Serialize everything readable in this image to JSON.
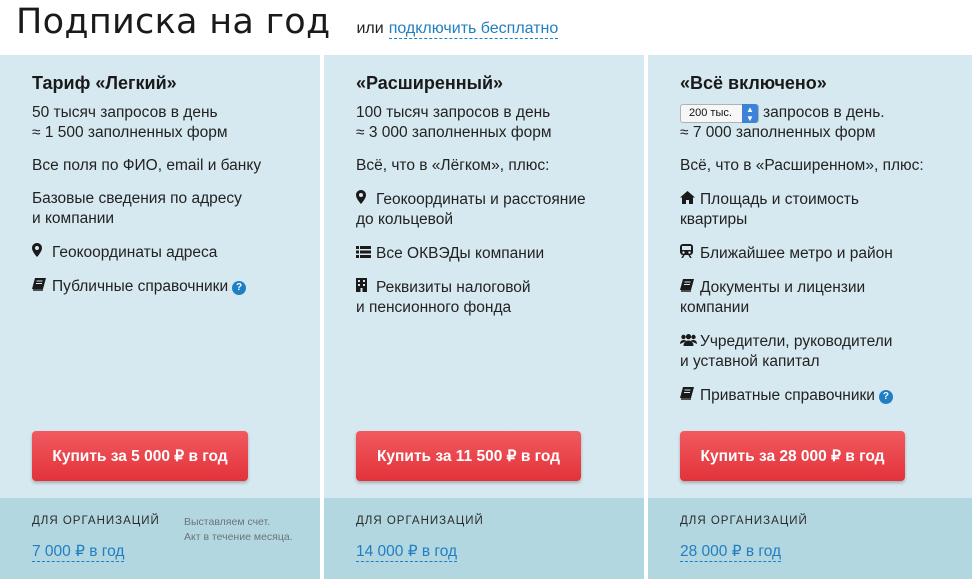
{
  "header": {
    "title": "Подписка на год",
    "or_text": "или",
    "free_link": "подключить бесплатно"
  },
  "plans": [
    {
      "title": "Тариф «Легкий»",
      "quota_lines": [
        "50 тысяч запросов в день",
        "≈ 1 500 заполненных форм"
      ],
      "intro": "Все поля по ФИО, email и банку",
      "features": [
        {
          "text": [
            "Базовые сведения по адресу",
            "и компании"
          ],
          "icon": ""
        },
        {
          "text": [
            "Геокоординаты адреса"
          ],
          "icon": "map-marker-icon"
        },
        {
          "text": [
            "Публичные справочники"
          ],
          "icon": "book-icon",
          "help": true
        }
      ],
      "buy_label": "Купить за 5 000 ₽ в год",
      "org_label": "ДЛЯ ОРГАНИЗАЦИЙ",
      "org_price": "7 000 ₽ в год",
      "org_note": [
        "Выставляем счет.",
        "Акт в течение месяца."
      ]
    },
    {
      "title": "«Расширенный»",
      "quota_lines": [
        "100 тысяч запросов в день",
        "≈ 3 000 заполненных форм"
      ],
      "intro": "Всё, что в «Лёгком», плюс:",
      "features": [
        {
          "text": [
            "Геокоординаты и расстояние",
            "до кольцевой"
          ],
          "icon": "map-marker-icon"
        },
        {
          "text": [
            "Все ОКВЭДы компании"
          ],
          "icon": "list-icon"
        },
        {
          "text": [
            "Реквизиты налоговой",
            "и пенсионного фонда"
          ],
          "icon": "building-icon"
        }
      ],
      "buy_label": "Купить за 11 500 ₽ в год",
      "org_label": "ДЛЯ ОРГАНИЗАЦИЙ",
      "org_price": "14 000 ₽ в год"
    },
    {
      "title": "«Всё включено»",
      "quota_select": "200 тыс.",
      "quota_suffix": "запросов в день.",
      "quota_line2": "≈ 7 000 заполненных форм",
      "intro": "Всё, что в «Расширенном», плюс:",
      "features": [
        {
          "text": [
            "Площадь и стоимость",
            "квартиры"
          ],
          "icon": "home-icon"
        },
        {
          "text": [
            "Ближайшее метро и район"
          ],
          "icon": "subway-icon"
        },
        {
          "text": [
            "Документы и лицензии",
            "компании"
          ],
          "icon": "book-icon"
        },
        {
          "text": [
            "Учредители, руководители",
            "и уставной капитал"
          ],
          "icon": "users-icon"
        },
        {
          "text": [
            "Приватные справочники"
          ],
          "icon": "book-icon",
          "help": true
        }
      ],
      "buy_label": "Купить за 28 000 ₽ в год",
      "org_label": "ДЛЯ ОРГАНИЗАЦИЙ",
      "org_price": "28 000 ₽ в год"
    }
  ],
  "help_glyph": "?",
  "colors": {
    "card_bg": "#d7e9f0",
    "footer_bg": "#b2d7e0",
    "button": "#e8383f",
    "link": "#1f7fc2"
  }
}
